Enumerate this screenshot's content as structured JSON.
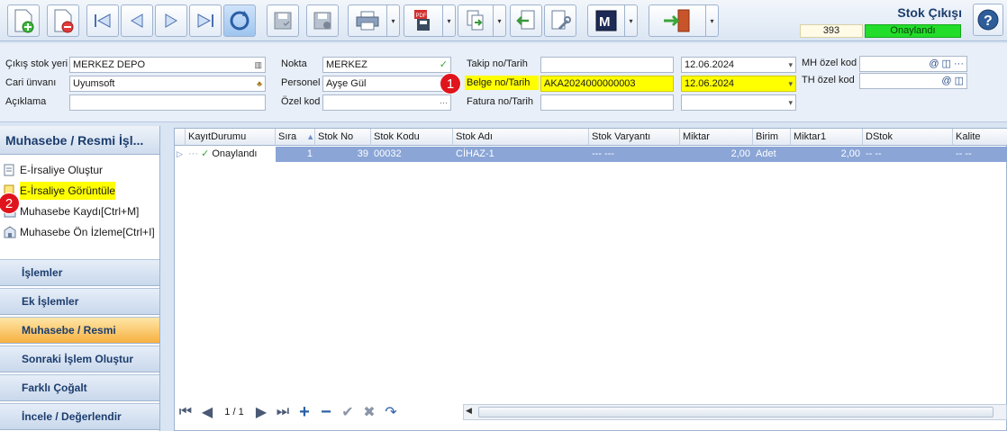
{
  "header": {
    "title": "Stok Çıkışı",
    "count": "393",
    "status": "Onaylandı"
  },
  "form": {
    "cikis_stok_yeri": {
      "label": "Çıkış stok yeri",
      "value": "MERKEZ DEPO"
    },
    "cari_unvani": {
      "label": "Cari ünvanı",
      "value": "Uyumsoft"
    },
    "aciklama": {
      "label": "Açıklama",
      "value": ""
    },
    "nokta": {
      "label": "Nokta",
      "value": "MERKEZ"
    },
    "personel": {
      "label": "Personel",
      "value": "Ayşe Gül"
    },
    "ozel_kod": {
      "label": "Özel kod",
      "value": ""
    },
    "takip_no": {
      "label": "Takip no/Tarih",
      "value": "",
      "date": "12.06.2024"
    },
    "belge_no": {
      "label": "Belge no/Tarih",
      "value": "AKA2024000000003",
      "date": "12.06.2024"
    },
    "fatura_no": {
      "label": "Fatura no/Tarih",
      "value": "",
      "date": ""
    },
    "mh_ozel_kod": {
      "label": "MH özel kod",
      "value": ""
    },
    "th_ozel_kod": {
      "label": "TH özel kod",
      "value": ""
    }
  },
  "badges": {
    "one": "1",
    "two": "2"
  },
  "left_panel": {
    "header": "Muhasebe / Resmi İşl...",
    "items": [
      {
        "label": "E-İrsaliye Oluştur"
      },
      {
        "label": "E-İrsaliye Görüntüle"
      },
      {
        "label": "Muhasebe Kaydı[Ctrl+M]"
      },
      {
        "label": "Muhasebe Ön İzleme[Ctrl+I]"
      }
    ],
    "groups": [
      {
        "label": "İşlemler"
      },
      {
        "label": "Ek İşlemler"
      },
      {
        "label": "Muhasebe / Resmi İşlemler"
      },
      {
        "label": "Sonraki İşlem Oluştur"
      },
      {
        "label": "Farklı Çoğalt"
      },
      {
        "label": "İncele / Değerlendir"
      }
    ]
  },
  "grid": {
    "columns": [
      "KayıtDurumu",
      "Sıra",
      "Stok No",
      "Stok Kodu",
      "Stok Adı",
      "Stok Varyantı",
      "Miktar",
      "Birim",
      "Miktar1",
      "DStok",
      "Kalite"
    ],
    "rows": [
      {
        "kayit_durumu": "Onaylandı",
        "sira": "1",
        "stok_no": "39",
        "stok_kodu": "00032",
        "stok_adi": "CİHAZ-1",
        "stok_varyanti": "--- ---",
        "miktar": "2,00",
        "birim": "Adet",
        "miktar1": "2,00",
        "dstok": "-- --",
        "kalite": "-- --"
      }
    ],
    "pager": "1 / 1"
  },
  "colors": {
    "accent": "#1c3d6e",
    "highlight": "#ffff00",
    "approved": "#22dd2a",
    "selected_row": "#8aa5d6"
  }
}
